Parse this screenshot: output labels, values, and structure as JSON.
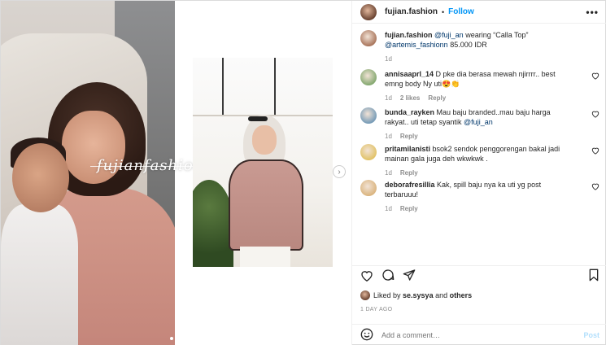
{
  "header": {
    "username": "fujian.fashion",
    "separator": "•",
    "follow_label": "Follow",
    "more_label": "•••"
  },
  "media": {
    "watermark": "fujianfashion",
    "next_icon": "chevron-right-icon"
  },
  "comments": [
    {
      "user": "fujian.fashion",
      "parts": [
        {
          "t": "text",
          "v": " "
        },
        {
          "t": "mention",
          "v": "@fuji_an"
        },
        {
          "t": "text",
          "v": " wearing “Calla Top” "
        },
        {
          "t": "mention",
          "v": "@artemis_fashionn"
        },
        {
          "t": "text",
          "v": " 85.000 IDR"
        }
      ],
      "meta": [
        "1d"
      ],
      "heart": false
    },
    {
      "user": "annisaaprl_14",
      "parts": [
        {
          "t": "text",
          "v": " D pke dia berasa mewah njirrrr.. best emng body Ny uti😍👏"
        }
      ],
      "meta": [
        "1d",
        "2 likes",
        "Reply"
      ],
      "heart": true
    },
    {
      "user": "bunda_rayken",
      "parts": [
        {
          "t": "text",
          "v": " Mau baju branded..mau baju harga rakyat.. uti tetap syantik "
        },
        {
          "t": "mention",
          "v": "@fuji_an"
        }
      ],
      "meta": [
        "1d",
        "Reply"
      ],
      "heart": true
    },
    {
      "user": "pritamilanisti",
      "parts": [
        {
          "t": "text",
          "v": " bsok2 sendok penggorengan bakal jadi mainan gala juga deh wkwkwk ."
        }
      ],
      "meta": [
        "1d",
        "Reply"
      ],
      "heart": true
    },
    {
      "user": "deborafresillia",
      "parts": [
        {
          "t": "text",
          "v": " Kak, spill baju nya ka uti yg post terbaruuu!"
        }
      ],
      "meta": [
        "1d",
        "Reply"
      ],
      "heart": true
    }
  ],
  "likes": {
    "prefix": "Liked by ",
    "user": "se.sysya",
    "middle": " and ",
    "others": "others"
  },
  "timestamp": "1 DAY AGO",
  "add_comment": {
    "placeholder": "Add a comment…",
    "post_label": "Post"
  },
  "colors": {
    "accent": "#0095f6",
    "post_disabled": "#b2dffc",
    "muted": "#8e8e8e"
  }
}
